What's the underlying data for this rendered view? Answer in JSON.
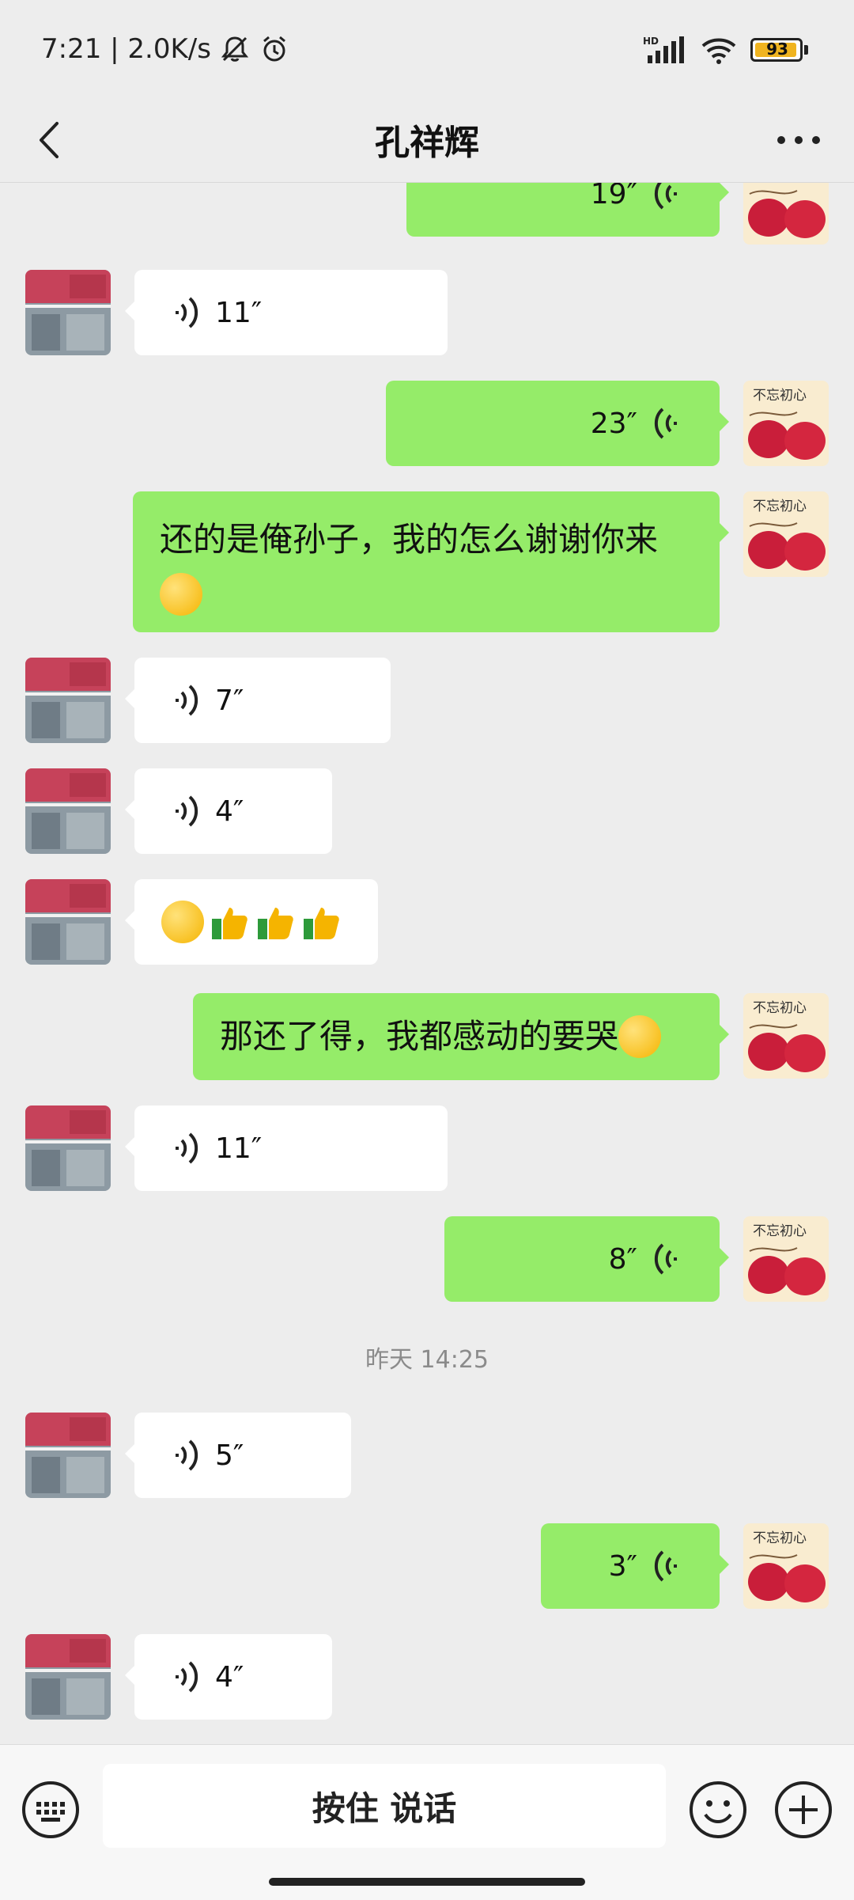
{
  "status_bar": {
    "time_speed": "7:21 | 2.0K/s",
    "network_label": "HD",
    "battery": "93"
  },
  "header": {
    "title": "孔祥辉"
  },
  "messages": [
    {
      "dir": "out",
      "type": "voice",
      "duration": "19″"
    },
    {
      "dir": "in",
      "type": "voice",
      "duration": "11″"
    },
    {
      "dir": "out",
      "type": "voice",
      "duration": "23″"
    },
    {
      "dir": "out",
      "type": "text",
      "text": "还的是俺孙子，我的怎么谢谢你来"
    },
    {
      "dir": "in",
      "type": "voice",
      "duration": "7″"
    },
    {
      "dir": "in",
      "type": "voice",
      "duration": "4″"
    },
    {
      "dir": "in",
      "type": "emoji"
    },
    {
      "dir": "out",
      "type": "text",
      "text": "那还了得，我都感动的要哭"
    },
    {
      "dir": "in",
      "type": "voice",
      "duration": "11″"
    },
    {
      "dir": "out",
      "type": "voice",
      "duration": "8″"
    },
    {
      "type": "timestamp",
      "text": "昨天 14:25"
    },
    {
      "dir": "in",
      "type": "voice",
      "duration": "5″"
    },
    {
      "dir": "out",
      "type": "voice",
      "duration": "3″"
    },
    {
      "dir": "in",
      "type": "voice",
      "duration": "4″"
    }
  ],
  "avatar_text": {
    "self": "不忘初心"
  },
  "input_bar": {
    "hold_to_talk": "按住 说话"
  },
  "colors": {
    "background": "#ededed",
    "outgoing_bubble": "#95ec69",
    "incoming_bubble": "#ffffff",
    "battery": "#f0b420"
  }
}
